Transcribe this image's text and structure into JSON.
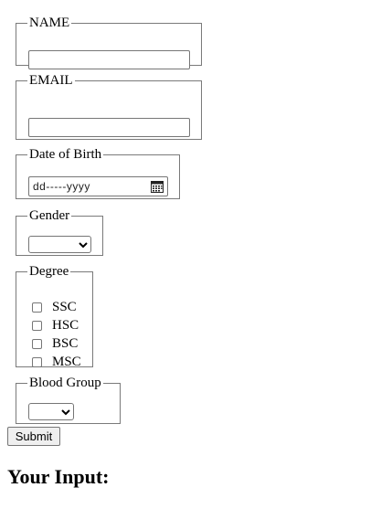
{
  "form": {
    "name": {
      "legend": "NAME",
      "value": ""
    },
    "email": {
      "legend": "EMAIL",
      "value": ""
    },
    "dob": {
      "legend": "Date of Birth",
      "placeholder": "dd-----yyyy"
    },
    "gender": {
      "legend": "Gender",
      "selected": ""
    },
    "degree": {
      "legend": "Degree",
      "options": [
        {
          "label": "SSC",
          "checked": false
        },
        {
          "label": "HSC",
          "checked": false
        },
        {
          "label": "BSC",
          "checked": false
        },
        {
          "label": "MSC",
          "checked": false
        }
      ]
    },
    "blood_group": {
      "legend": "Blood Group",
      "selected": ""
    },
    "submit_label": "Submit"
  },
  "output": {
    "heading": "Your Input:"
  }
}
